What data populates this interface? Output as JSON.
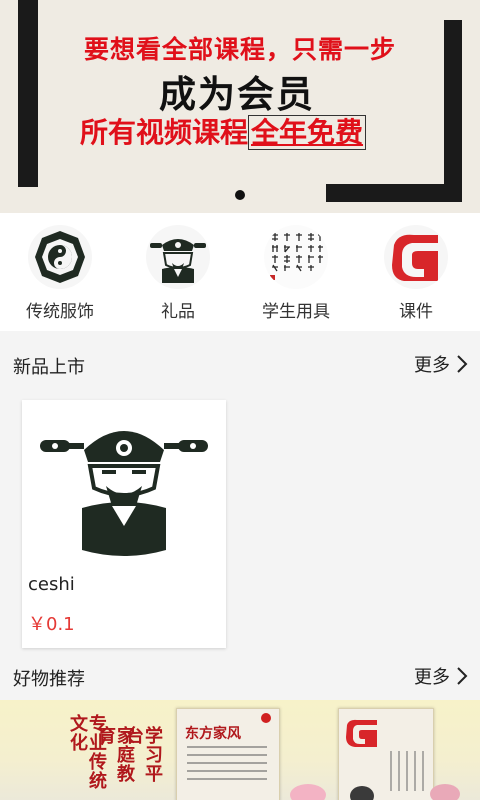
{
  "banner": {
    "line1": "要想看全部课程，只需一步",
    "line2": "成为会员",
    "line3_prefix": "所有视频课程",
    "line3_highlight": "全年免费"
  },
  "categories": [
    {
      "label": "传统服饰",
      "icon": "bagua-icon"
    },
    {
      "label": "礼品",
      "icon": "scholar-figure-icon"
    },
    {
      "label": "学生用具",
      "icon": "calligraphy-icon"
    },
    {
      "label": "课件",
      "icon": "red-seal-icon"
    }
  ],
  "new_arrivals": {
    "title": "新品上市",
    "more": "更多",
    "products": [
      {
        "name": "ceshi",
        "price": "￥0.1"
      }
    ]
  },
  "recommend": {
    "title": "好物推荐",
    "more": "更多"
  },
  "bottom_banner": {
    "col1": "专业传统文化",
    "col2": "家庭教育",
    "col3": "学习平台",
    "card1_title": "东方家风"
  },
  "colors": {
    "accent_red": "#e0101a",
    "price_red": "#e53935",
    "banner_bg": "#efebe3"
  }
}
